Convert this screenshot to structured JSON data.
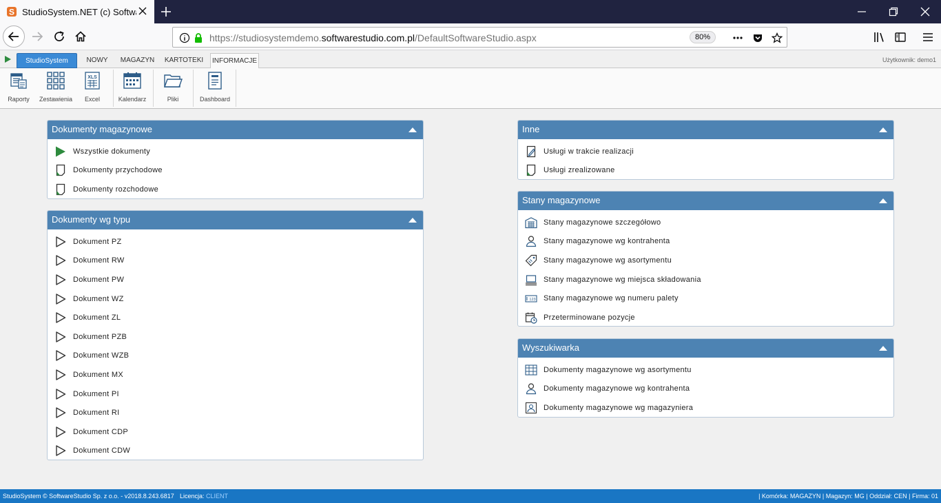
{
  "browser": {
    "tab_title": "StudioSystem.NET (c) Software",
    "url_prefix": "https://studiosystemdemo.",
    "url_domain": "softwarestudio.com.pl",
    "url_path": "/DefaultSoftwareStudio.aspx",
    "zoom": "80%"
  },
  "app": {
    "brand_tab": "StudioSystem",
    "tabs": [
      "NOWY",
      "MAGAZYN",
      "KARTOTEKI",
      "INFORMACJE"
    ],
    "active_tab": "INFORMACJE",
    "user": "Użytkownik: demo1"
  },
  "ribbon": {
    "raporty": "Raporty",
    "zestawienia": "Zestawienia",
    "excel": "Excel",
    "kalendarz": "Kalendarz",
    "pliki": "Pliki",
    "dashboard": "Dashboard"
  },
  "panels": {
    "dok_mag": {
      "title": "Dokumenty magazynowe",
      "items": [
        "Wszystkie dokumenty",
        "Dokumenty przychodowe",
        "Dokumenty rozchodowe"
      ]
    },
    "dok_typ": {
      "title": "Dokumenty wg typu",
      "items": [
        "Dokument PZ",
        "Dokument RW",
        "Dokument PW",
        "Dokument WZ",
        "Dokument ZL",
        "Dokument PZB",
        "Dokument WZB",
        "Dokument MX",
        "Dokument PI",
        "Dokument RI",
        "Dokument CDP",
        "Dokument CDW"
      ]
    },
    "inne": {
      "title": "Inne",
      "items": [
        "Usługi w trakcie realizacji",
        "Usługi zrealizowane"
      ]
    },
    "stany": {
      "title": "Stany magazynowe",
      "items": [
        "Stany magazynowe szczegółowo",
        "Stany magazynowe wg kontrahenta",
        "Stany magazynowe wg asortymentu",
        "Stany magazynowe wg miejsca składowania",
        "Stany magazynowe wg numeru palety",
        "Przeterminowane pozycje"
      ]
    },
    "wysz": {
      "title": "Wyszukiwarka",
      "items": [
        "Dokumenty magazynowe wg asortymentu",
        "Dokumenty magazynowe wg kontrahenta",
        "Dokumenty magazynowe wg magazyniera"
      ]
    }
  },
  "status": {
    "left": "StudioSystem © SoftwareStudio Sp. z o.o. - v2018.8.243.6817",
    "license_label": "Licencja: ",
    "license_value": "CLIENT",
    "right": "| Komórka: MAGAZYN | Magazyn: MG | Oddział: CEN | Firma: 01"
  },
  "colors": {
    "panel_header": "#4d83b3",
    "status_bar": "#1976c4",
    "brand_tab": "#3a8ad6",
    "icon_green": "#2e8b3e"
  }
}
